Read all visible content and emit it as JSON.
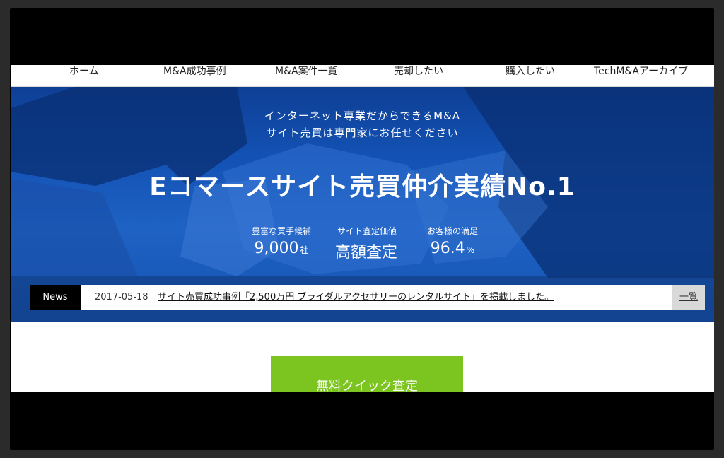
{
  "nav": {
    "items": [
      {
        "label": "ホーム"
      },
      {
        "label": "M&A成功事例"
      },
      {
        "label": "M&A案件一覧"
      },
      {
        "label": "売却したい"
      },
      {
        "label": "購入したい"
      },
      {
        "label": "TechM&Aアーカイブ"
      }
    ]
  },
  "hero": {
    "subtitle_line1": "インターネット専業だからできるM&A",
    "subtitle_line2": "サイト売買は専門家にお任せください",
    "title": "Eコマースサイト売買仲介実績No.1",
    "stats": [
      {
        "label": "豊富な買手候補",
        "value": "9,000",
        "unit": "社"
      },
      {
        "label": "サイト査定価値",
        "value": "高額査定",
        "unit": ""
      },
      {
        "label": "お客様の満足",
        "value": "96.4",
        "unit": "%"
      }
    ]
  },
  "news": {
    "label": "News",
    "date": "2017-05-18",
    "headline": "サイト売買成功事例「2,500万円 ブライダルアクセサリーのレンタルサイト」を掲載しました。",
    "more_label": "一覧"
  },
  "cta": {
    "label": "無料クイック査定"
  },
  "colors": {
    "hero_blue": "#1352b4",
    "cta_green": "#7cc520",
    "news_label_bg": "#000000"
  }
}
